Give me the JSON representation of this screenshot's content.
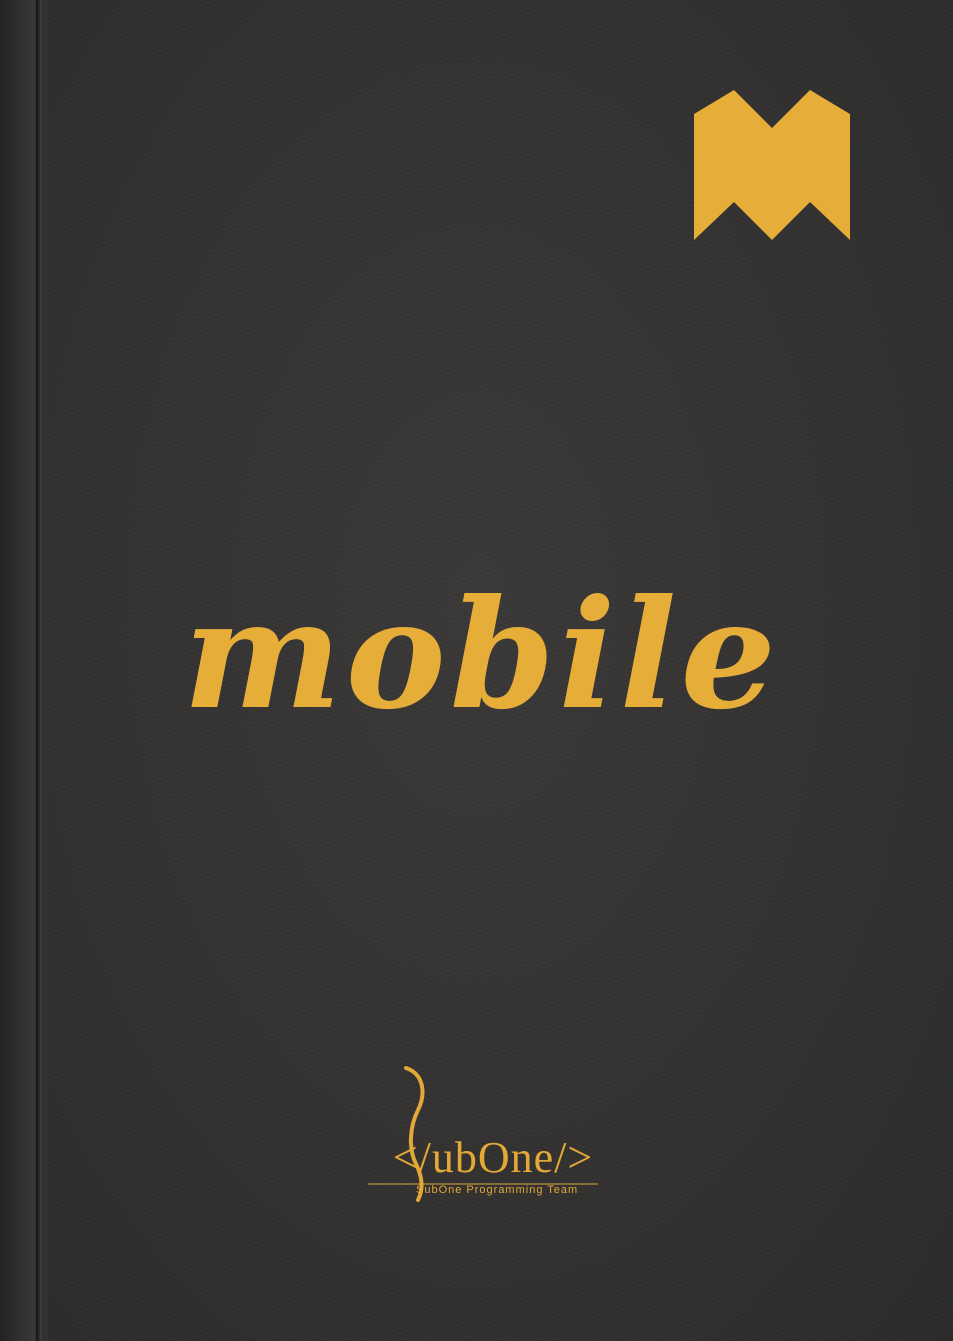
{
  "cover": {
    "title": "mobile",
    "brand_mark_icon": "zigzag-m-icon",
    "team_logo": {
      "wordmark": "</ubOne/>",
      "tagline": "SubOne Programming Team"
    }
  },
  "colors": {
    "background": "#333231",
    "accent": "#e7ad39"
  }
}
